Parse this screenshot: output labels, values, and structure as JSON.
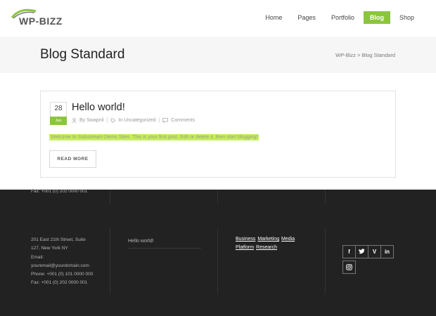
{
  "header": {
    "logo_text": "WP-BIZZ",
    "nav": [
      {
        "label": "Home"
      },
      {
        "label": "Pages"
      },
      {
        "label": "Portfolio"
      },
      {
        "label": "Blog"
      },
      {
        "label": "Shop"
      }
    ],
    "active_nav": "Blog"
  },
  "title_band": {
    "title": "Blog Standard",
    "breadcrumb": "WP-Bizz > Blog Standard"
  },
  "post": {
    "day": "28",
    "month": "Jan",
    "title": "Hello world!",
    "author": "By Swapnil",
    "category": "In Uncategorized",
    "comments": "Comments",
    "excerpt": "Welcome to Solostream Demo Sites. This is your first post. Edit or delete it, then start blogging!",
    "read_more": "READ MORE"
  },
  "footer": {
    "top_fax": "Fax: +001 (0) 202 0000 001",
    "address_lines": [
      "201 East 21th Street, Suite",
      "127, New York NY",
      "Email:",
      "youremail@yourdomain.com",
      "Phone: +001 (0) 101 0000 000",
      "Fax: +001 (0) 202 0000 001"
    ],
    "recent_post": "Hello world!",
    "tags": [
      "Business",
      "Marketing",
      "Media",
      "Platform",
      "Research"
    ],
    "social": [
      {
        "icon": "facebook-icon",
        "glyph": "f"
      },
      {
        "icon": "twitter-icon",
        "glyph": "t"
      },
      {
        "icon": "vine-icon",
        "glyph": "V"
      },
      {
        "icon": "linkedin-icon",
        "glyph": "in"
      },
      {
        "icon": "instagram-icon",
        "glyph": ""
      }
    ]
  },
  "colors": {
    "accent": "#8bc53f",
    "footer_bg": "#222222",
    "title_band_bg": "#f6f6f6",
    "excerpt_highlight": "#c6ef5a"
  }
}
